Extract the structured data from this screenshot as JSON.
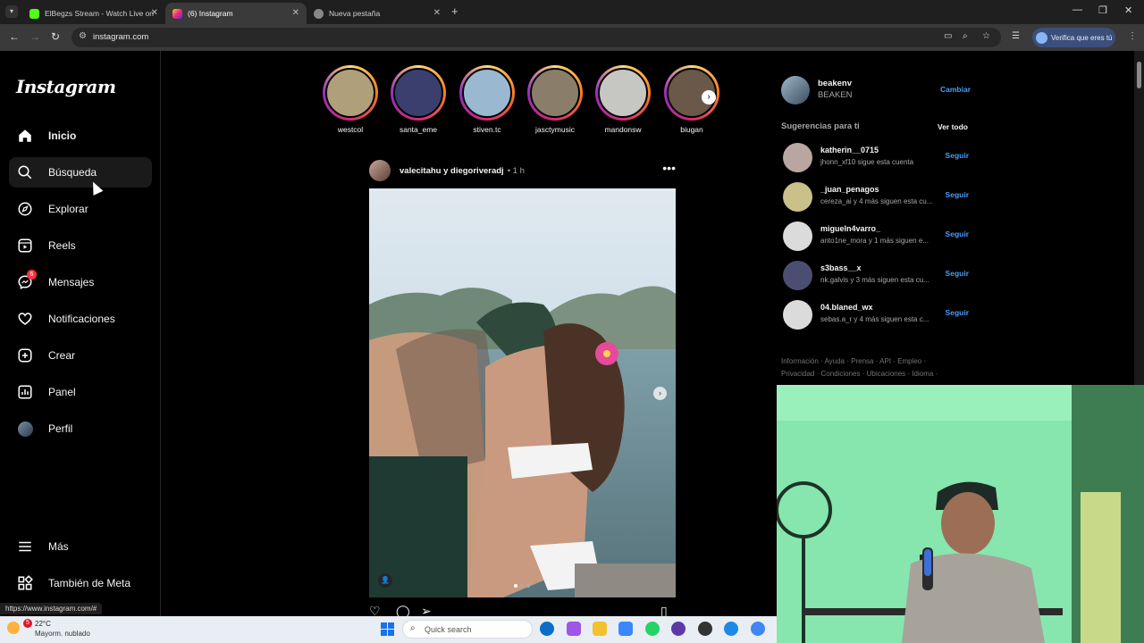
{
  "browser": {
    "tabs": [
      {
        "title": "ElBegzs Stream - Watch Live on",
        "active": false
      },
      {
        "title": "(6) Instagram",
        "active": true
      },
      {
        "title": "Nueva pestaña",
        "active": false
      }
    ],
    "url": "instagram.com",
    "verify_label": "Verifica que eres tú",
    "status_url": "https://www.instagram.com/#"
  },
  "sidebar": {
    "logo": "Instagram",
    "items": [
      {
        "label": "Inicio",
        "icon": "home-icon"
      },
      {
        "label": "Búsqueda",
        "icon": "search-icon"
      },
      {
        "label": "Explorar",
        "icon": "compass-icon"
      },
      {
        "label": "Reels",
        "icon": "reels-icon"
      },
      {
        "label": "Mensajes",
        "icon": "messenger-icon",
        "badge": "6"
      },
      {
        "label": "Notificaciones",
        "icon": "heart-icon"
      },
      {
        "label": "Crear",
        "icon": "plus-square-icon"
      },
      {
        "label": "Panel",
        "icon": "chart-icon"
      },
      {
        "label": "Perfil",
        "icon": "avatar"
      }
    ],
    "bottom": [
      {
        "label": "Más",
        "icon": "menu-icon"
      },
      {
        "label": "También de Meta",
        "icon": "meta-grid-icon"
      }
    ]
  },
  "stories": [
    {
      "name": "westcol",
      "color": "#b0a07a"
    },
    {
      "name": "santa_eme",
      "color": "#3a3f6e"
    },
    {
      "name": "stiven.tc",
      "color": "#9ab8cf"
    },
    {
      "name": "jasctymusic",
      "color": "#8a7e6a"
    },
    {
      "name": "mandonsw",
      "color": "#c6c6c2"
    },
    {
      "name": "biugan",
      "color": "#6a5848"
    }
  ],
  "post": {
    "authors": "valecitahu y diegoriveradj",
    "time": "• 1 h"
  },
  "account": {
    "username": "beakenv",
    "name": "BEAKEN",
    "switch_label": "Cambiar"
  },
  "suggestions": {
    "title": "Sugerencias para ti",
    "see_all": "Ver todo",
    "follow_label": "Seguir",
    "items": [
      {
        "user": "katherin__0715",
        "sub": "jhonn_xf10 sigue esta cuenta",
        "color": "#b8a7a0"
      },
      {
        "user": "_juan_penagos",
        "sub": "cereza_ai y 4 más siguen esta cu...",
        "color": "#c9c08a"
      },
      {
        "user": "migueln4varro_",
        "sub": "anto1ne_mora y 1 más siguen e...",
        "color": "#dbdbdb"
      },
      {
        "user": "s3bass__x",
        "sub": "nk.galvis y 3 más siguen esta cu...",
        "color": "#4a4f72"
      },
      {
        "user": "04.blaned_wx",
        "sub": "sebas.a_r y 4 más siguen esta c...",
        "color": "#dbdbdb"
      }
    ]
  },
  "footer": {
    "line1": "Información · Ayuda · Prensa · API · Empleo ·",
    "line2": "Privacidad · Condiciones · Ubicaciones · Idioma ·"
  },
  "taskbar": {
    "weather_badge": "5",
    "temp": "22°C",
    "desc": "Mayorm. nublado",
    "search_placeholder": "Quick search"
  }
}
